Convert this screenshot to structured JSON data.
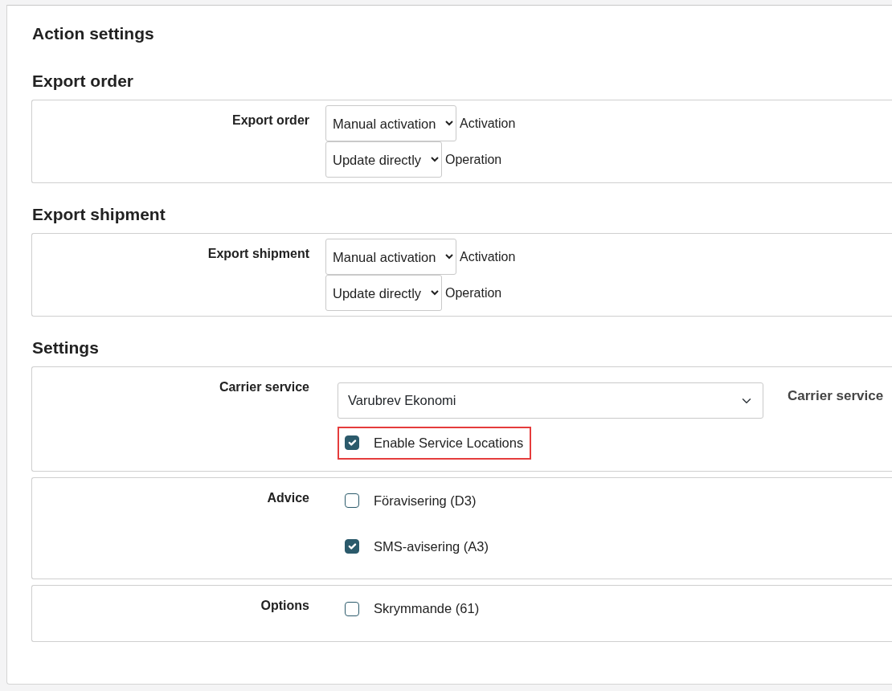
{
  "title": "Action settings",
  "sections": [
    {
      "heading": "Export order",
      "groups": [
        {
          "label": "Export order",
          "items": [
            {
              "kind": "select",
              "value": "Manual activation",
              "caption": "Activation"
            },
            {
              "kind": "select",
              "value": "Update directly",
              "caption": "Operation"
            }
          ]
        }
      ]
    },
    {
      "heading": "Export shipment",
      "groups": [
        {
          "label": "Export shipment",
          "items": [
            {
              "kind": "select",
              "value": "Manual activation",
              "caption": "Activation"
            },
            {
              "kind": "select",
              "value": "Update directly",
              "caption": "Operation"
            }
          ]
        }
      ]
    },
    {
      "heading": "Settings",
      "groups": [
        {
          "label": "Carrier service",
          "items": [
            {
              "kind": "wide_select",
              "value": "Varubrev Ekonomi",
              "caption": "Carrier service"
            },
            {
              "kind": "checkbox",
              "label": "Enable Service Locations",
              "checked": true,
              "highlighted": true
            }
          ]
        },
        {
          "label": "Advice",
          "items": [
            {
              "kind": "checkbox",
              "label": "Föravisering (D3)",
              "checked": false,
              "highlighted": false
            },
            {
              "kind": "checkbox",
              "label": "SMS-avisering (A3)",
              "checked": true,
              "highlighted": false
            }
          ]
        },
        {
          "label": "Options",
          "items": [
            {
              "kind": "checkbox",
              "label": "Skrymmande (61)",
              "checked": false,
              "highlighted": false
            }
          ]
        }
      ]
    }
  ]
}
